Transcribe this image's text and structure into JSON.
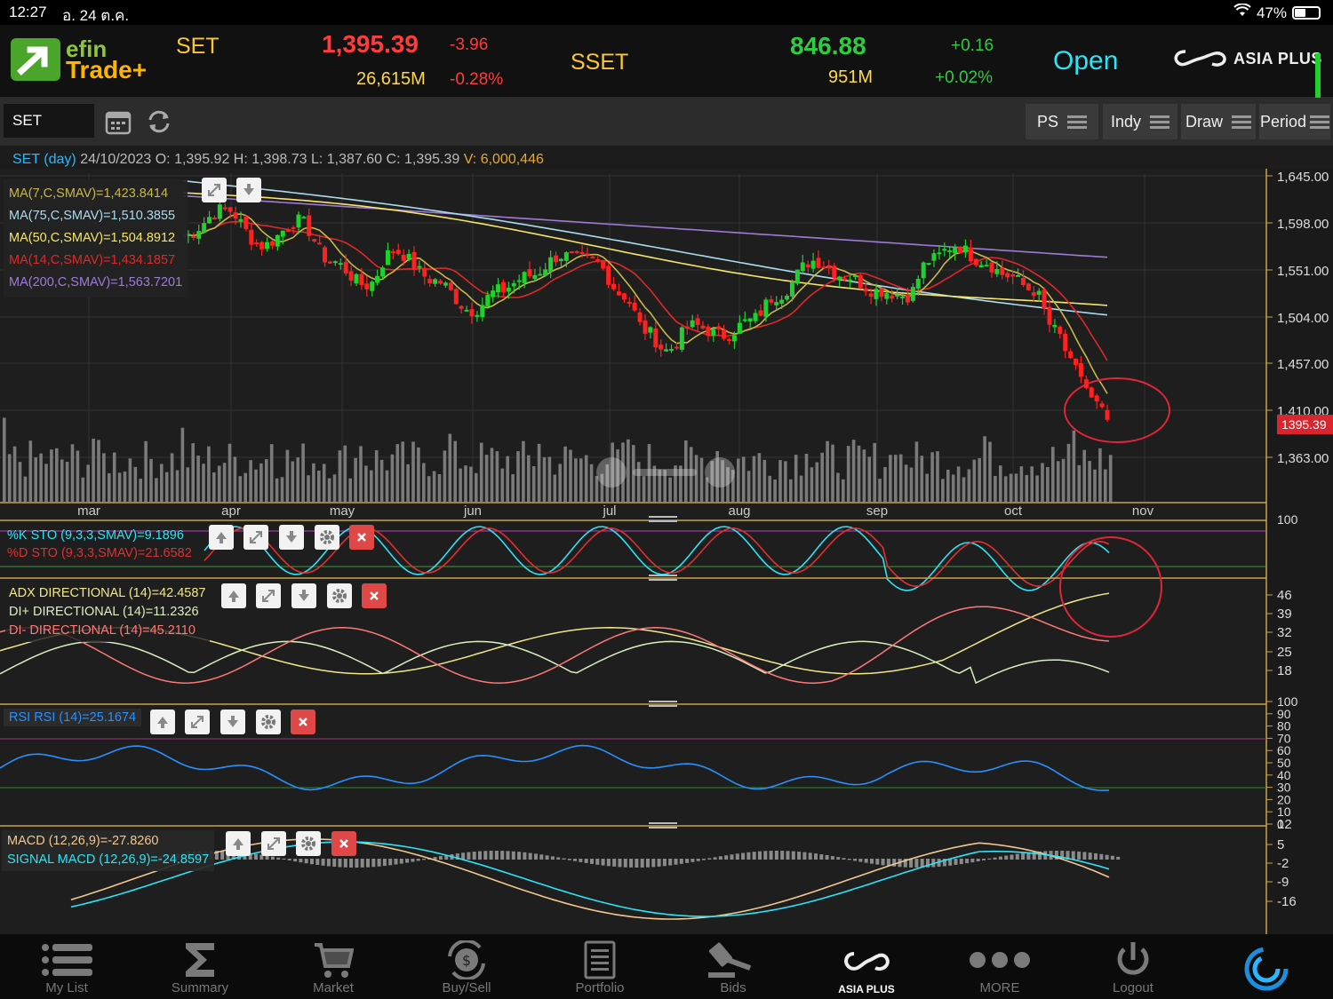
{
  "status_bar": {
    "time": "12:27",
    "date": "อ. 24 ต.ค.",
    "battery": "47%",
    "battery_level": 0.47
  },
  "header": {
    "logo_line1": "efin",
    "logo_line2": "Trade+",
    "set": {
      "name": "SET",
      "value": "1,395.39",
      "change": "-3.96",
      "volume": "26,615M",
      "percent": "-0.28%"
    },
    "sset": {
      "name": "SSET",
      "value": "846.88",
      "change": "+0.16",
      "volume": "951M",
      "percent": "+0.02%"
    },
    "market_status": "Open",
    "broker": "ASIA PLUS"
  },
  "toolbar": {
    "symbol": "SET",
    "buttons": [
      {
        "label": "PS"
      },
      {
        "label": "Indy"
      },
      {
        "label": "Draw"
      },
      {
        "label": "Period"
      }
    ]
  },
  "info_line": {
    "symbol_label": "SET (day)",
    "date": "24/10/2023",
    "o_label": "O:",
    "o": "1,395.92",
    "h_label": "H:",
    "h": "1,398.73",
    "l_label": "L:",
    "l": "1,387.60",
    "c_label": "C:",
    "c": "1,395.39",
    "v_label": "V:",
    "v": "6,000,446"
  },
  "main_chart": {
    "ma_legend": [
      {
        "text": "MA(7,C,SMAV)=1,423.8414",
        "color": "#c8b84a"
      },
      {
        "text": "MA(75,C,SMAV)=1,510.3855",
        "color": "#a9dcef"
      },
      {
        "text": "MA(50,C,SMAV)=1,504.8912",
        "color": "#f5e66b"
      },
      {
        "text": "MA(14,C,SMAV)=1,434.1857",
        "color": "#e02828"
      },
      {
        "text": "MA(200,C,SMAV)=1,563.7201",
        "color": "#a07ad8"
      }
    ],
    "price_ticks": [
      "1,645.00",
      "1,598.00",
      "1,551.00",
      "1,504.00",
      "1,457.00",
      "1,410.00",
      "1,363.00"
    ],
    "last_price_tag": "1395.39",
    "months": [
      "mar",
      "apr",
      "may",
      "jun",
      "jul",
      "aug",
      "sep",
      "oct",
      "nov"
    ]
  },
  "indicators": {
    "sto": {
      "k": "%K STO (9,3,3,SMAV)=9.1896",
      "d": "%D STO (9,3,3,SMAV)=21.6582",
      "top_tick": "100"
    },
    "adx": {
      "adx": "ADX DIRECTIONAL (14)=42.4587",
      "di_plus": "DI+ DIRECTIONAL (14)=11.2326",
      "di_minus": "DI- DIRECTIONAL (14)=45.2110",
      "ticks": [
        "46",
        "39",
        "32",
        "25",
        "18"
      ]
    },
    "rsi": {
      "label": "RSI RSI (14)=25.1674",
      "ticks": [
        "100",
        "90",
        "80",
        "70",
        "60",
        "50",
        "40",
        "30",
        "20",
        "10",
        "0"
      ]
    },
    "macd": {
      "macd": "MACD (12,26,9)=-27.8260",
      "signal": "SIGNAL MACD (12,26,9)=-24.8597",
      "ticks": [
        "12",
        "5",
        "-2",
        "-9",
        "-16"
      ]
    }
  },
  "colors": {
    "bull": "#1ed12d",
    "bear": "#ff2020",
    "accent_cyan": "#2ee3f5",
    "highlight_circle": "#e0253a"
  },
  "bottom_nav": [
    {
      "label": "My List",
      "icon": "list-icon"
    },
    {
      "label": "Summary",
      "icon": "sigma-icon"
    },
    {
      "label": "Market",
      "icon": "cart-icon"
    },
    {
      "label": "Buy/Sell",
      "icon": "buy-sell-icon"
    },
    {
      "label": "Portfolio",
      "icon": "portfolio-icon"
    },
    {
      "label": "Bids",
      "icon": "gavel-icon"
    },
    {
      "label": "ASIA PLUS",
      "icon": "asia-plus-icon"
    },
    {
      "label": "MORE",
      "icon": "more-icon"
    },
    {
      "label": "Logout",
      "icon": "power-icon"
    },
    {
      "label": "",
      "icon": "spinner-icon"
    }
  ]
}
